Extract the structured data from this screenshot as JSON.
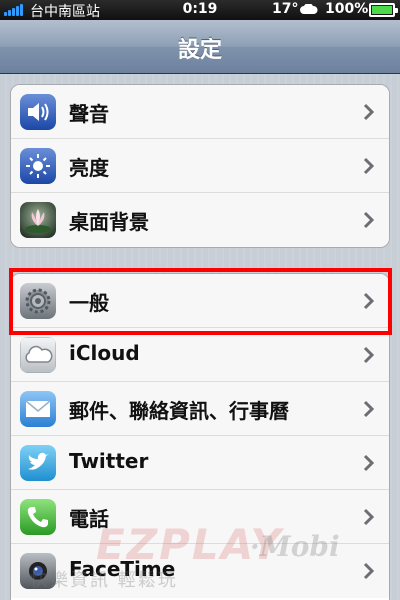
{
  "status_bar": {
    "carrier": "台中南區站",
    "time": "0:19",
    "temperature": "17°",
    "battery": "100%",
    "battery_level": 1.0,
    "weather_icon": "cloud-icon"
  },
  "nav": {
    "title": "設定"
  },
  "groups": [
    {
      "items": [
        {
          "label": "聲音",
          "icon": "speaker-icon"
        },
        {
          "label": "亮度",
          "icon": "brightness-icon"
        },
        {
          "label": "桌面背景",
          "icon": "wallpaper-icon"
        }
      ]
    },
    {
      "items": [
        {
          "label": "一般",
          "icon": "gear-icon",
          "highlighted": true
        },
        {
          "label": "iCloud",
          "icon": "icloud-icon"
        },
        {
          "label": "郵件、聯絡資訊、行事曆",
          "icon": "mail-icon"
        },
        {
          "label": "Twitter",
          "icon": "twitter-icon"
        },
        {
          "label": "電話",
          "icon": "phone-icon"
        },
        {
          "label": "FaceTime",
          "icon": "facetime-icon"
        }
      ]
    }
  ],
  "highlight_color": "#ff0000",
  "watermark": {
    "main": "EZPLAY",
    "mobi": "·Mobi",
    "sub": "快樂資訊 輕鬆玩"
  }
}
